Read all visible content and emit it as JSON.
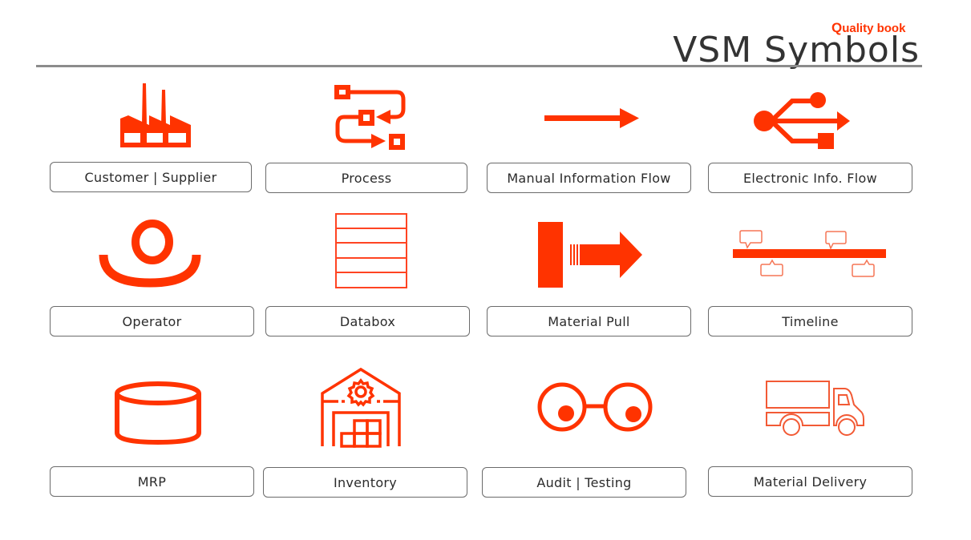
{
  "header": {
    "title": "VSM Symbols",
    "brand_mark": "Q",
    "brand_text": "uality book"
  },
  "colors": {
    "accent": "#ff3300",
    "label_border": "#6b6b6b",
    "title": "#333333",
    "rule": "#8c8c8c"
  },
  "symbols": [
    {
      "label": "Customer | Supplier",
      "icon": "factory-icon"
    },
    {
      "label": "Process",
      "icon": "process-flow-icon"
    },
    {
      "label": "Manual Information Flow",
      "icon": "arrow-right-icon"
    },
    {
      "label": "Electronic Info. Flow",
      "icon": "usb-icon"
    },
    {
      "label": "Operator",
      "icon": "operator-icon"
    },
    {
      "label": "Databox",
      "icon": "databox-icon"
    },
    {
      "label": "Material Pull",
      "icon": "material-pull-icon"
    },
    {
      "label": "Timeline",
      "icon": "timeline-icon"
    },
    {
      "label": "MRP",
      "icon": "cylinder-icon"
    },
    {
      "label": "Inventory",
      "icon": "warehouse-icon"
    },
    {
      "label": "Audit | Testing",
      "icon": "eyes-icon"
    },
    {
      "label": "Material Delivery",
      "icon": "truck-icon"
    }
  ]
}
